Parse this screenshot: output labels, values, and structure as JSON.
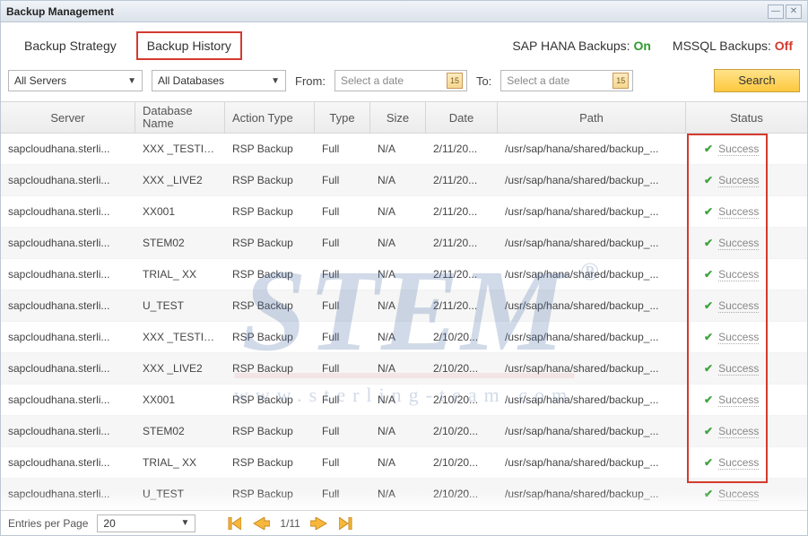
{
  "window": {
    "title": "Backup Management"
  },
  "tabs": {
    "strategy": "Backup Strategy",
    "history": "Backup History"
  },
  "backup_states": {
    "hana_label": "SAP HANA Backups:",
    "hana_state": "On",
    "mssql_label": "MSSQL Backups:",
    "mssql_state": "Off"
  },
  "filters": {
    "server_select": "All Servers",
    "db_select": "All Databases",
    "from_label": "From:",
    "to_label": "To:",
    "from_placeholder": "Select a date",
    "to_placeholder": "Select a date",
    "cal_icon_day": "15",
    "search_label": "Search"
  },
  "headers": {
    "server": "Server",
    "db": "Database Name",
    "action": "Action Type",
    "type": "Type",
    "size": "Size",
    "date": "Date",
    "path": "Path",
    "status": "Status"
  },
  "rows": [
    {
      "server": "sapcloudhana.sterli...",
      "db": "XXX _TESTING",
      "action": "RSP Backup",
      "type": "Full",
      "size": "N/A",
      "date": "2/11/20...",
      "path": "/usr/sap/hana/shared/backup_...",
      "status": "Success"
    },
    {
      "server": "sapcloudhana.sterli...",
      "db": "XXX _LIVE2",
      "action": "RSP Backup",
      "type": "Full",
      "size": "N/A",
      "date": "2/11/20...",
      "path": "/usr/sap/hana/shared/backup_...",
      "status": "Success"
    },
    {
      "server": "sapcloudhana.sterli...",
      "db": "XX001",
      "action": "RSP Backup",
      "type": "Full",
      "size": "N/A",
      "date": "2/11/20...",
      "path": "/usr/sap/hana/shared/backup_...",
      "status": "Success"
    },
    {
      "server": "sapcloudhana.sterli...",
      "db": "STEM02",
      "action": "RSP Backup",
      "type": "Full",
      "size": "N/A",
      "date": "2/11/20...",
      "path": "/usr/sap/hana/shared/backup_...",
      "status": "Success"
    },
    {
      "server": "sapcloudhana.sterli...",
      "db": "TRIAL_ XX",
      "action": "RSP Backup",
      "type": "Full",
      "size": "N/A",
      "date": "2/11/20...",
      "path": "/usr/sap/hana/shared/backup_...",
      "status": "Success"
    },
    {
      "server": "sapcloudhana.sterli...",
      "db": "U_TEST",
      "action": "RSP Backup",
      "type": "Full",
      "size": "N/A",
      "date": "2/11/20...",
      "path": "/usr/sap/hana/shared/backup_...",
      "status": "Success"
    },
    {
      "server": "sapcloudhana.sterli...",
      "db": "XXX _TESTING",
      "action": "RSP Backup",
      "type": "Full",
      "size": "N/A",
      "date": "2/10/20...",
      "path": "/usr/sap/hana/shared/backup_...",
      "status": "Success"
    },
    {
      "server": "sapcloudhana.sterli...",
      "db": "XXX _LIVE2",
      "action": "RSP Backup",
      "type": "Full",
      "size": "N/A",
      "date": "2/10/20...",
      "path": "/usr/sap/hana/shared/backup_...",
      "status": "Success"
    },
    {
      "server": "sapcloudhana.sterli...",
      "db": "XX001",
      "action": "RSP Backup",
      "type": "Full",
      "size": "N/A",
      "date": "2/10/20...",
      "path": "/usr/sap/hana/shared/backup_...",
      "status": "Success"
    },
    {
      "server": "sapcloudhana.sterli...",
      "db": "STEM02",
      "action": "RSP Backup",
      "type": "Full",
      "size": "N/A",
      "date": "2/10/20...",
      "path": "/usr/sap/hana/shared/backup_...",
      "status": "Success"
    },
    {
      "server": "sapcloudhana.sterli...",
      "db": "TRIAL_ XX",
      "action": "RSP Backup",
      "type": "Full",
      "size": "N/A",
      "date": "2/10/20...",
      "path": "/usr/sap/hana/shared/backup_...",
      "status": "Success"
    },
    {
      "server": "sapcloudhana.sterli...",
      "db": "U_TEST",
      "action": "RSP Backup",
      "type": "Full",
      "size": "N/A",
      "date": "2/10/20...",
      "path": "/usr/sap/hana/shared/backup_...",
      "status": "Success"
    }
  ],
  "pager": {
    "entries_label": "Entries per Page",
    "entries_value": "20",
    "position": "1/11"
  },
  "watermark": {
    "brand": "STEM",
    "url": "www.sterling-team.com"
  }
}
